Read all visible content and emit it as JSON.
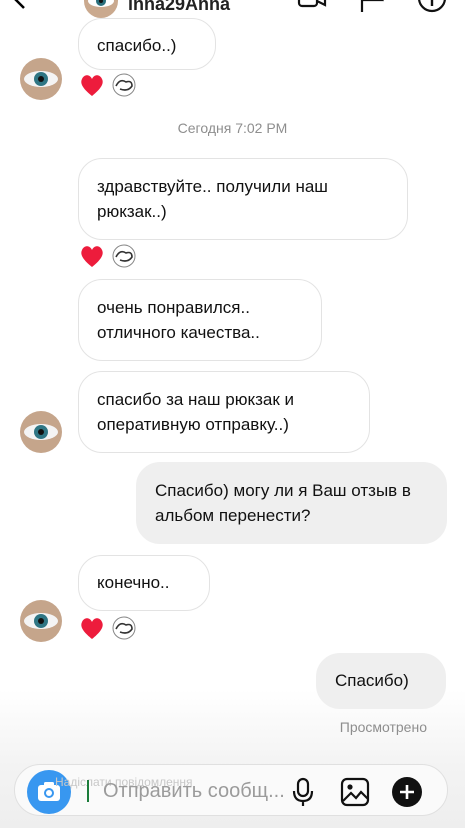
{
  "header": {
    "username": "inna29Anna",
    "back_icon": "arrow-left-icon",
    "video_icon": "video-camera-icon",
    "flag_icon": "flag-icon",
    "info_icon": "info-icon"
  },
  "timestamp": "Сегодня 7:02 PM",
  "messages": [
    {
      "text": "спасибо..)",
      "direction": "in"
    },
    {
      "text": "здравствуйте.. получили наш рюкзак..)",
      "direction": "in"
    },
    {
      "text": "очень понравился.. отличного качества..",
      "direction": "in"
    },
    {
      "text": "спасибо за наш рюкзак и оперативную отправку..)",
      "direction": "in"
    },
    {
      "text": "Спасибо) могу ли я Ваш отзыв в альбом перенести?",
      "direction": "out"
    },
    {
      "text": "конечно..",
      "direction": "in"
    },
    {
      "text": "Спасибо)",
      "direction": "out"
    }
  ],
  "reactions": {
    "heart_icon": "heart-icon",
    "face_icon": "reaction-face-icon"
  },
  "seen_label": "Просмотрено",
  "composer": {
    "placeholder": "Отправить сообщ...",
    "hint": "Надіслати повідомлення",
    "camera_icon": "camera-icon",
    "mic_icon": "microphone-icon",
    "gallery_icon": "gallery-icon",
    "plus_icon": "plus-icon"
  },
  "colors": {
    "accent": "#3897f0",
    "heart": "#ed1c3c",
    "outgoing_bubble": "#efefef"
  }
}
